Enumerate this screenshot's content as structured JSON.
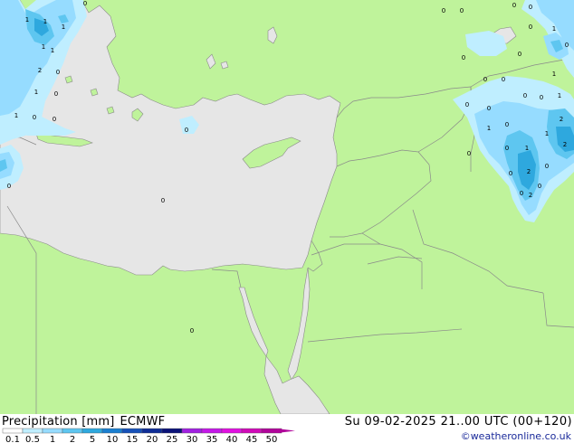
{
  "footer": {
    "product": "Precipitation [mm]",
    "model": "ECMWF",
    "valid_time": "Su 09-02-2025 21..00 UTC (00+120)",
    "credit": "©weatheronline.co.uk"
  },
  "legend": {
    "ticks": [
      "0.1",
      "0.5",
      "1",
      "2",
      "5",
      "10",
      "15",
      "20",
      "25",
      "30",
      "35",
      "40",
      "45",
      "50"
    ],
    "colors": [
      "#ffffff",
      "#bfeeff",
      "#96dcff",
      "#5ec6f0",
      "#2ea8de",
      "#1a7fd0",
      "#1650b8",
      "#0e2c96",
      "#0a1278",
      "#a020e0",
      "#c418e8",
      "#e010e0",
      "#d00ab8",
      "#b0049a"
    ]
  },
  "colors": {
    "land": "#bff39b",
    "sea": "#e6e6e6",
    "border": "#8a8a8a",
    "precip_light": "#bfeeff",
    "precip_mid": "#96dcff",
    "precip_strong": "#5ec6f0",
    "precip_heavy": "#2ea8de"
  },
  "map": {
    "precip_labels": [
      "1",
      "1",
      "1",
      "1",
      "1",
      "2",
      "0",
      "1",
      "0",
      "1",
      "0",
      "0",
      "0",
      "0",
      "0",
      "0",
      "0",
      "0",
      "0",
      "0",
      "0",
      "0",
      "1",
      "0",
      "0",
      "0",
      "0",
      "0",
      "0",
      "0",
      "0",
      "0",
      "1",
      "1",
      "0",
      "1",
      "1",
      "2",
      "1",
      "2",
      "0",
      "0",
      "2",
      "2",
      "0",
      "0",
      "0",
      "0"
    ]
  }
}
